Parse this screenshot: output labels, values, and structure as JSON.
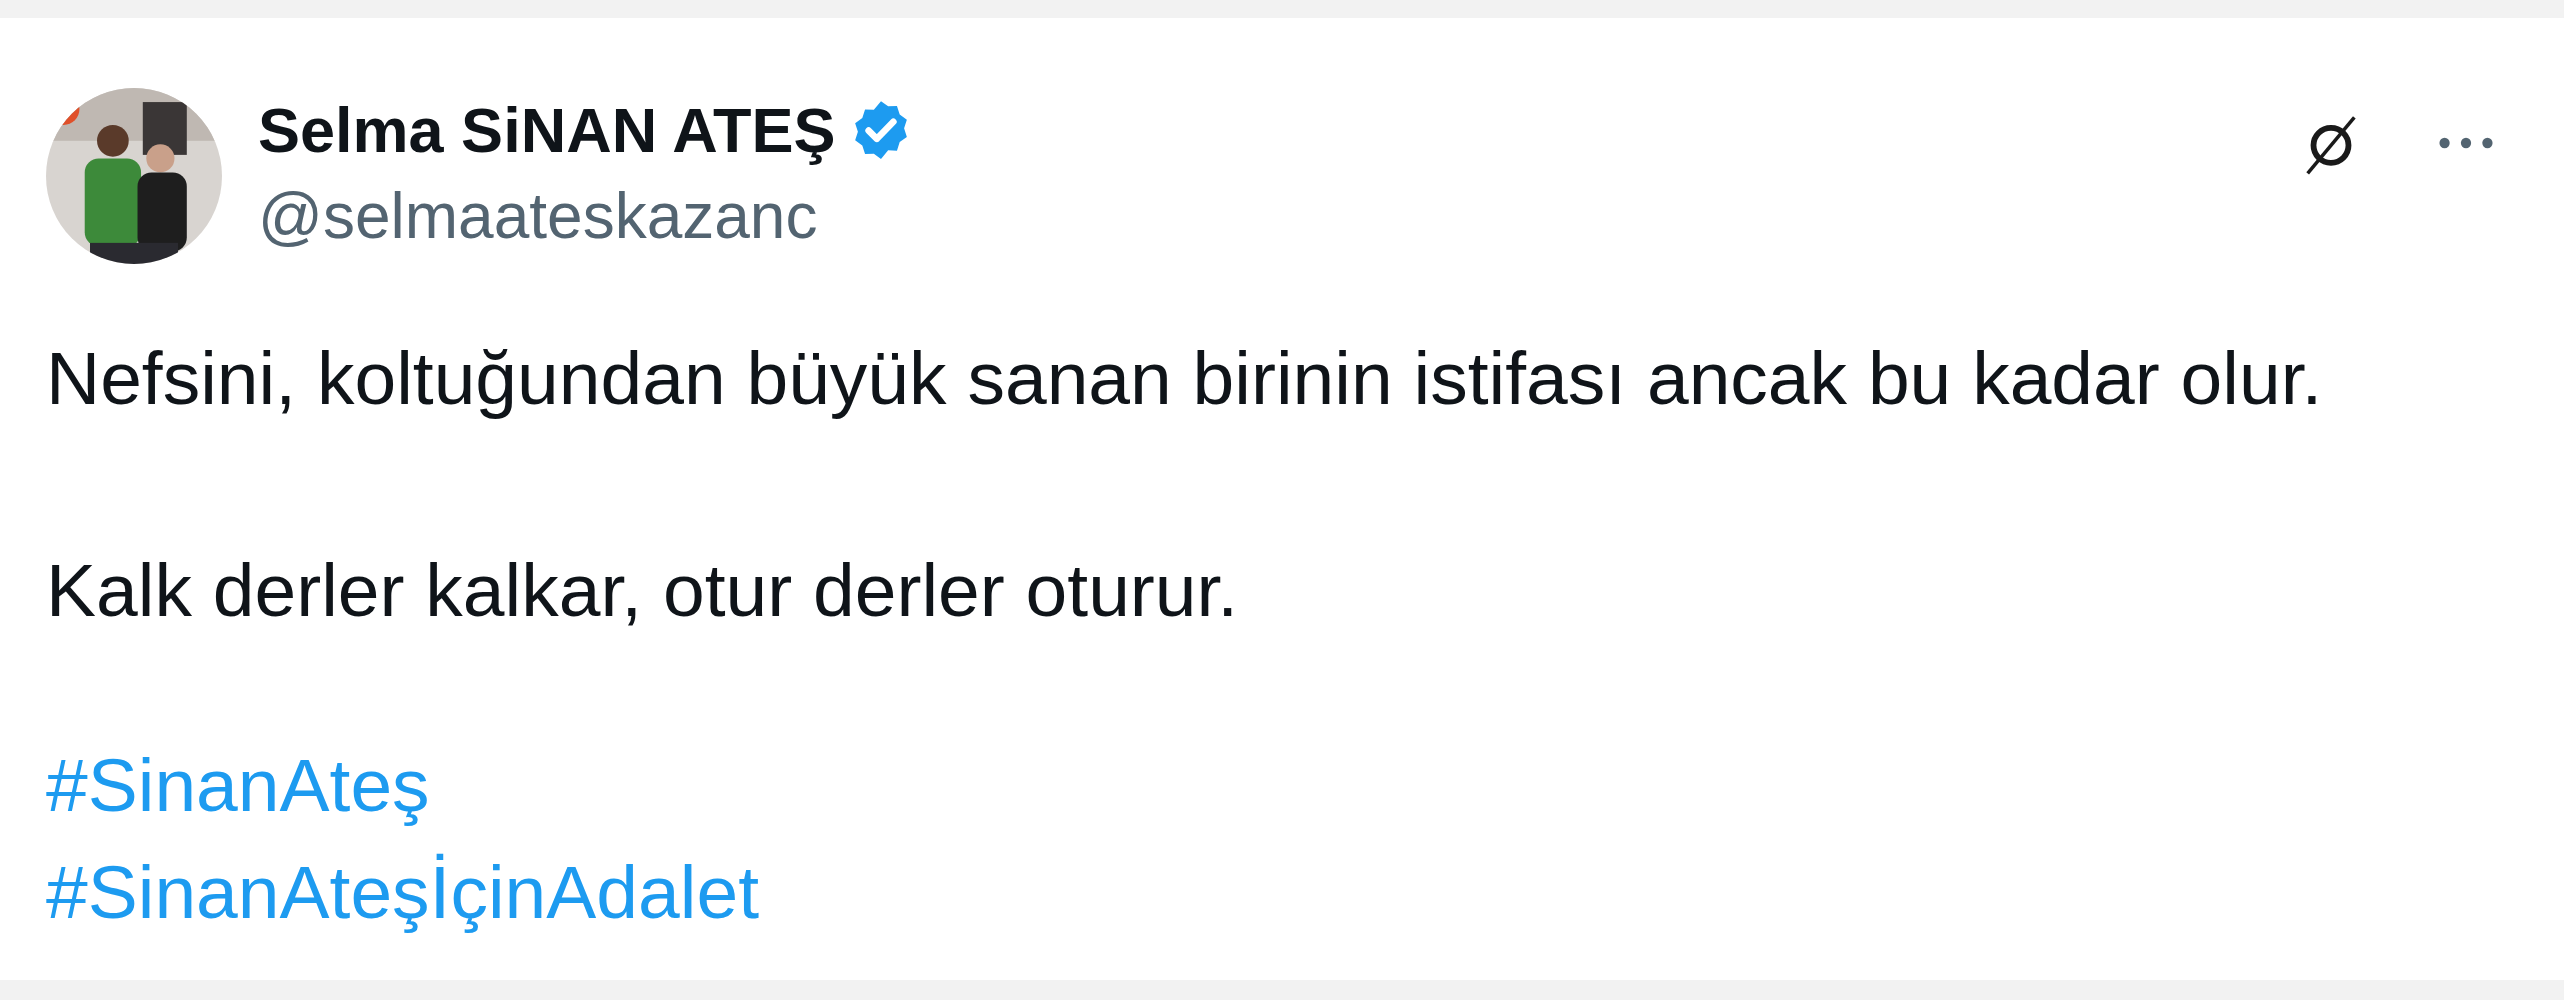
{
  "author": {
    "name": "Selma SiNAN ATEŞ",
    "verified": true,
    "handle": "@selmaateskazanc"
  },
  "paragraphs": [
    "Nefsini, koltuğundan büyük sanan birinin istifası ancak bu kadar olur.",
    "Kalk derler kalkar, otur derler oturur."
  ],
  "hashtags": [
    "#SinanAteş",
    "#SinanAteşİçinAdalet"
  ]
}
